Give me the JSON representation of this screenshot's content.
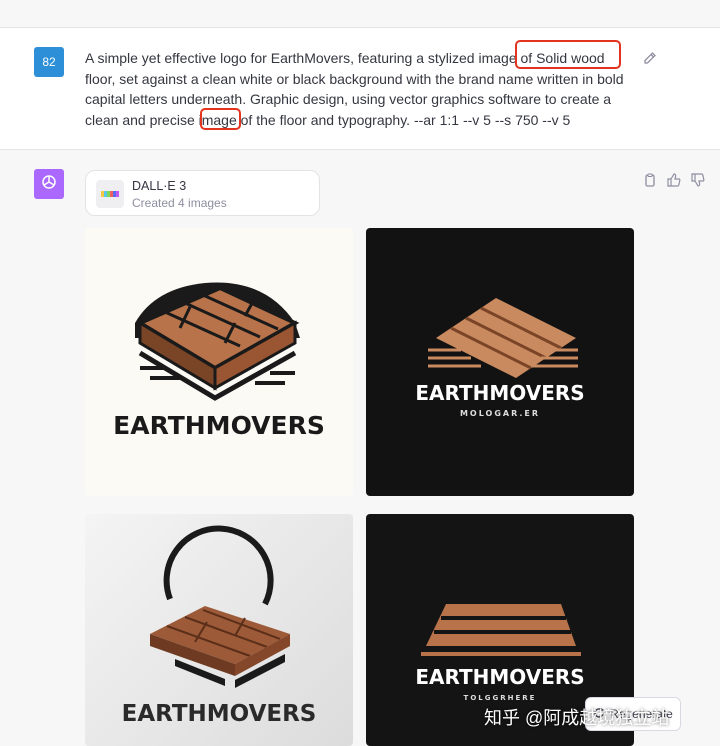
{
  "user": {
    "avatar_text": "82",
    "prompt": "A simple yet effective logo for EarthMovers, featuring a stylized image of Solid wood floor, set against a clean white or black background with the brand name written in bold capital letters underneath. Graphic design, using vector graphics software to create a clean and precise image of the floor and typography. --ar 1:1 --v 5 --s 750 --v 5"
  },
  "tool": {
    "name": "DALL·E 3",
    "status": "Created 4 images"
  },
  "images": [
    {
      "brand": "EARTHMOVERS",
      "tagline": ""
    },
    {
      "brand": "EARTHMOVERS",
      "tagline": "MOLOGAR.ER"
    },
    {
      "brand": "EARTHMOVERS",
      "tagline": ""
    },
    {
      "brand": "EARTHMOVERS",
      "tagline": "TOLGGRHERE"
    }
  ],
  "regenerate_label": "Regenerate",
  "watermark": "知乎 @阿成越境独立站",
  "colors": {
    "user_avatar": "#2d8fd8",
    "bot_avatar": "#ab68ff",
    "highlight": "#e3341f",
    "wood": "#b8734a"
  },
  "icons": [
    "edit-icon",
    "copy-icon",
    "thumbs-up-icon",
    "thumbs-down-icon",
    "openai-icon",
    "refresh-icon"
  ]
}
